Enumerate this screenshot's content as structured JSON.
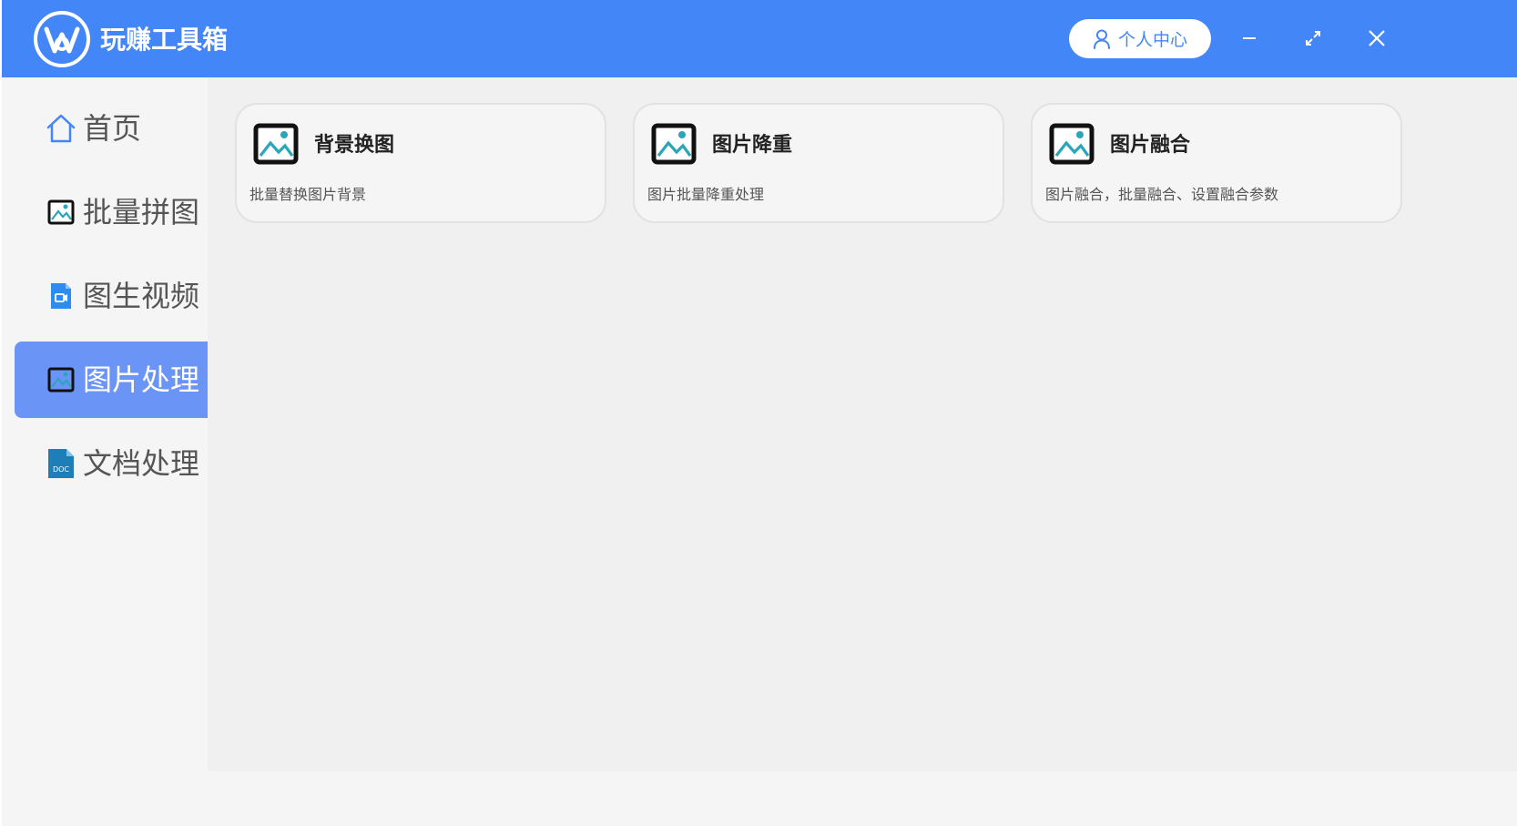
{
  "app": {
    "title": "玩赚工具箱",
    "accent_color": "#4386f8",
    "logo_icon": "w-circle-logo"
  },
  "header": {
    "user_button_label": "个人中心",
    "user_icon": "user-icon",
    "controls": [
      "minimize-icon",
      "maximize-icon",
      "close-icon"
    ]
  },
  "sidebar": {
    "items": [
      {
        "label": "首页",
        "icon": "home-icon",
        "active": false
      },
      {
        "label": "批量拼图",
        "icon": "image-icon",
        "active": false
      },
      {
        "label": "图生视频",
        "icon": "video-file-icon",
        "active": false
      },
      {
        "label": "图片处理",
        "icon": "image-icon",
        "active": true
      },
      {
        "label": "文档处理",
        "icon": "doc-file-icon",
        "active": false
      }
    ]
  },
  "main": {
    "cards": [
      {
        "title": "背景换图",
        "description": "批量替换图片背景",
        "icon": "image-icon"
      },
      {
        "title": "图片降重",
        "description": "图片批量降重处理",
        "icon": "image-icon"
      },
      {
        "title": "图片融合",
        "description": "图片融合，批量融合、设置融合参数",
        "icon": "image-icon"
      }
    ]
  }
}
